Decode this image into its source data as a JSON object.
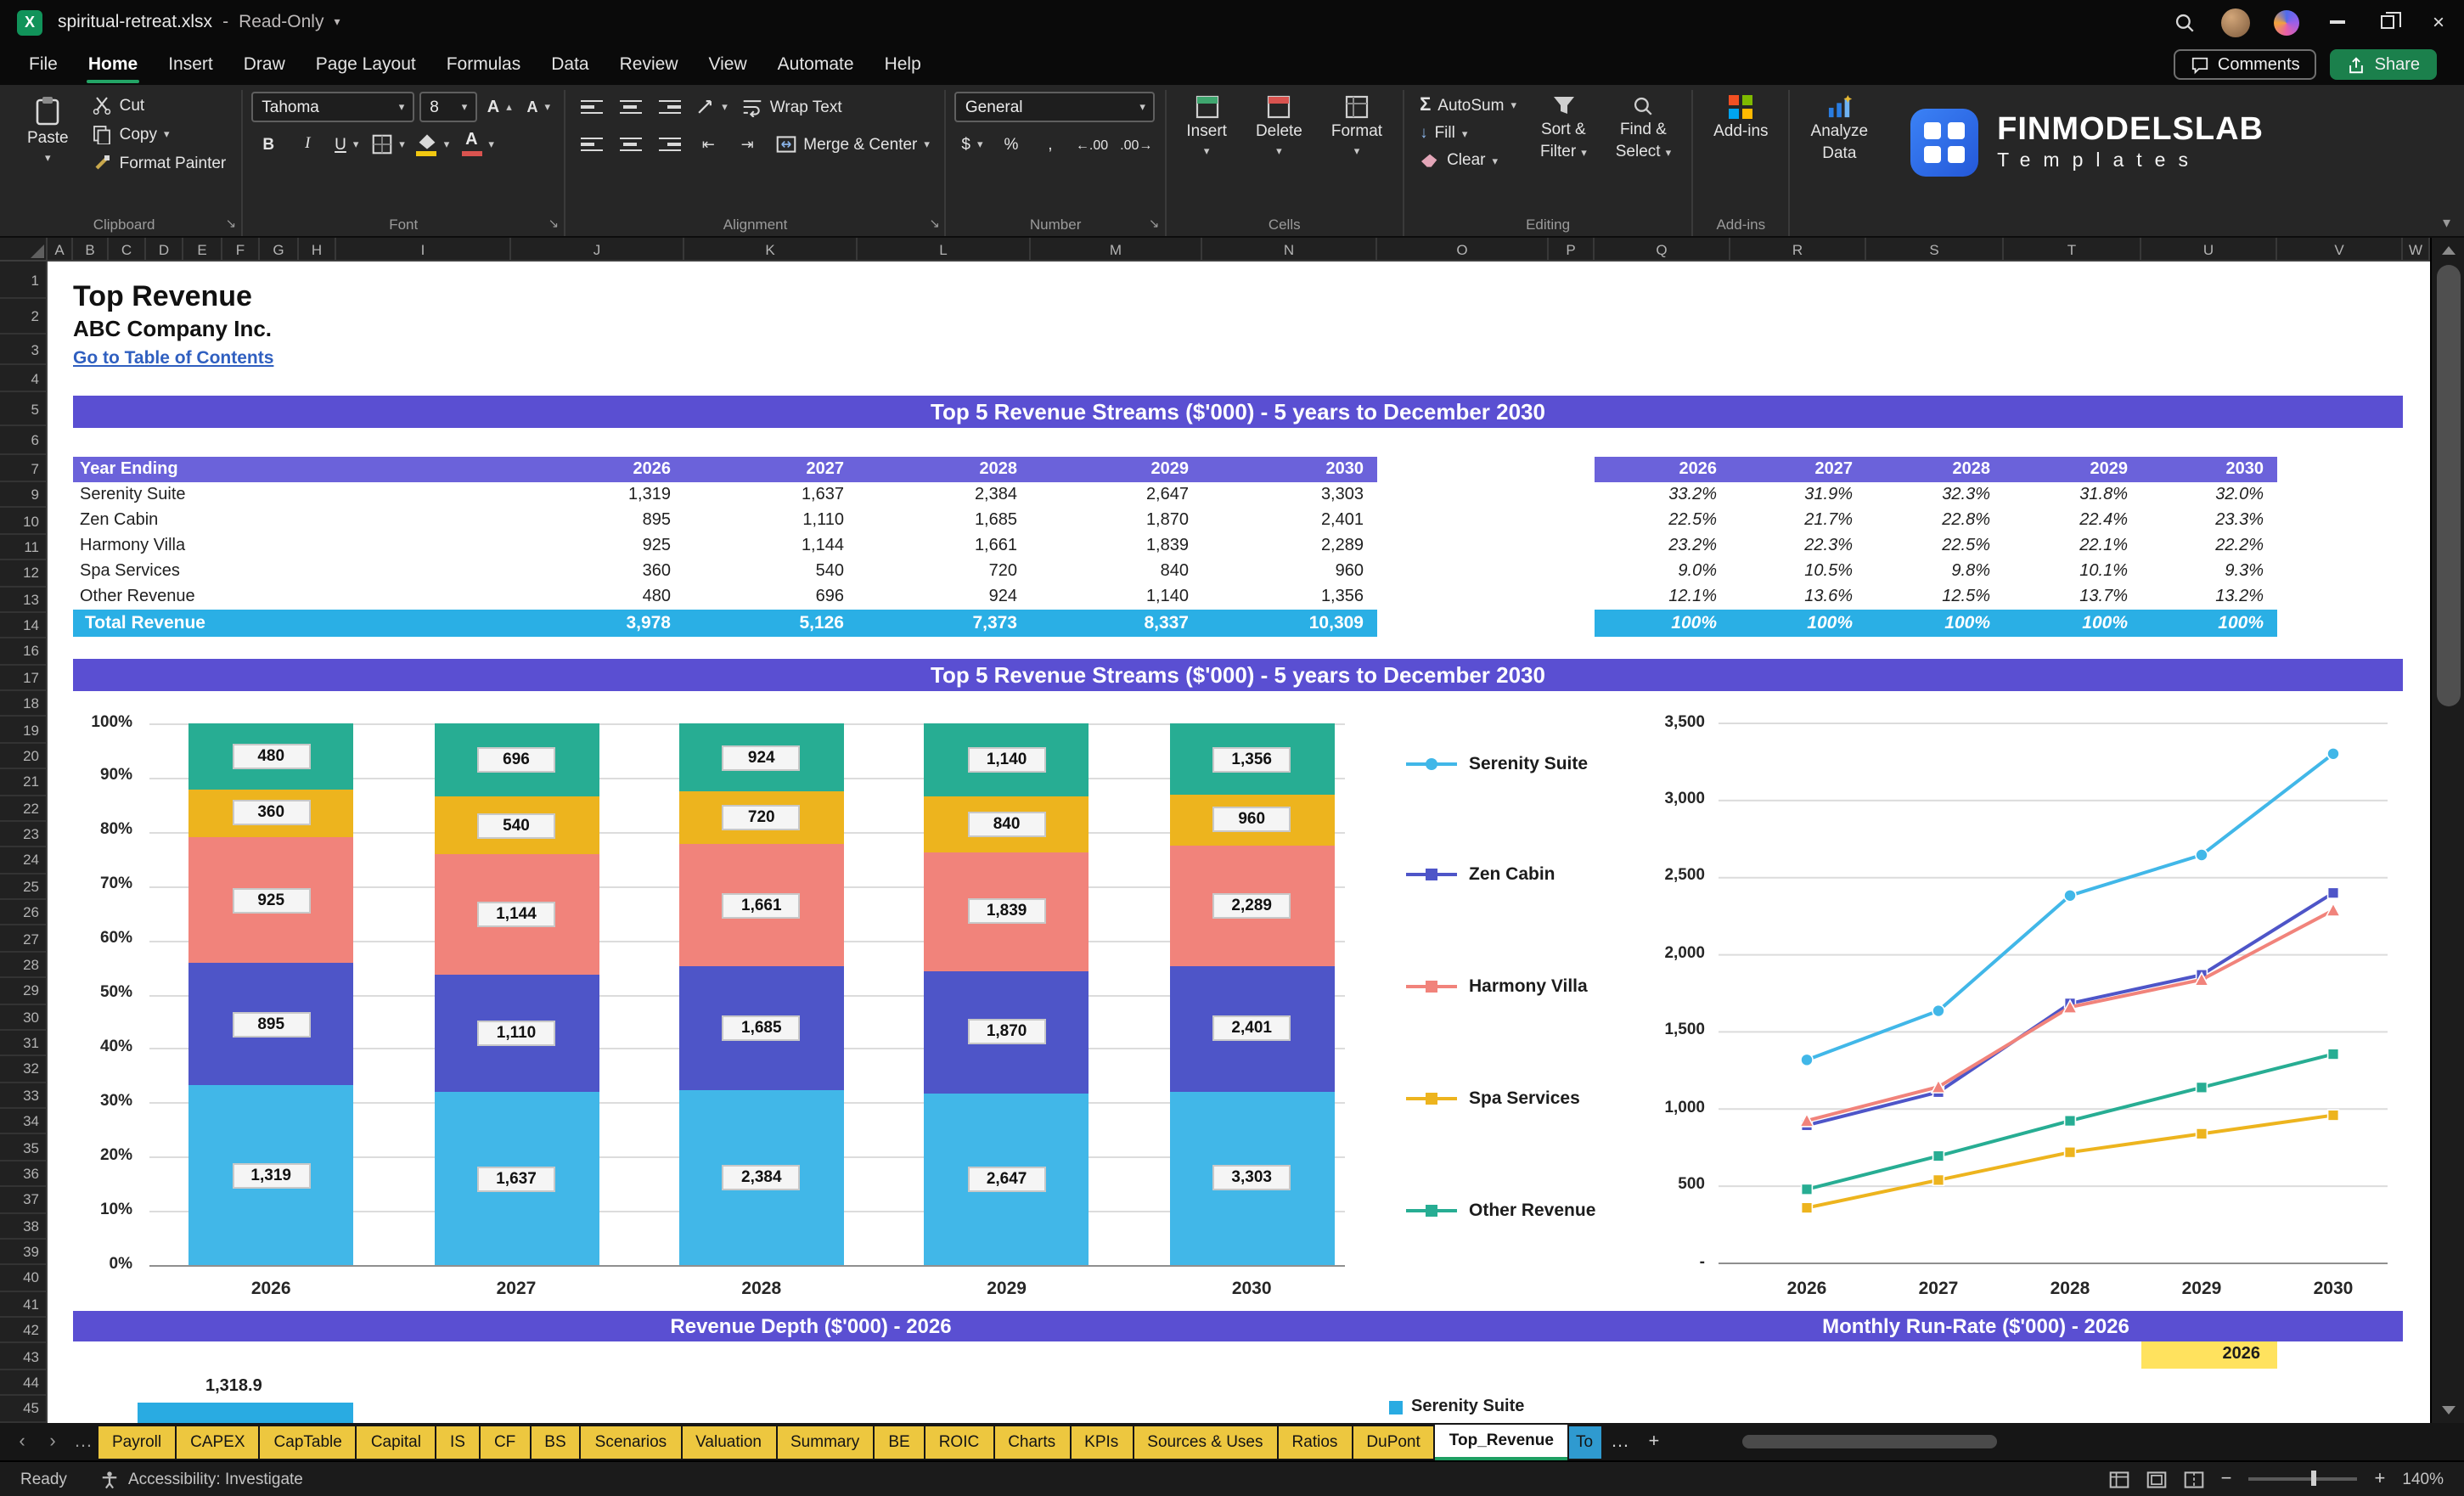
{
  "titlebar": {
    "filename": "spiritual-retreat.xlsx",
    "separator": "-",
    "mode": "Read-Only"
  },
  "menubar": {
    "tabs": [
      "File",
      "Home",
      "Insert",
      "Draw",
      "Page Layout",
      "Formulas",
      "Data",
      "Review",
      "View",
      "Automate",
      "Help"
    ],
    "active": "Home",
    "comments_label": "Comments",
    "share_label": "Share"
  },
  "ribbon": {
    "paste": "Paste",
    "cut": "Cut",
    "copy": "Copy",
    "format_painter": "Format Painter",
    "font_name": "Tahoma",
    "font_size": "8",
    "bold": "B",
    "italic": "I",
    "underline": "U",
    "wrap_text": "Wrap Text",
    "merge_center": "Merge & Center",
    "number_format": "General",
    "currency": "$",
    "percent": "%",
    "comma": ",",
    "inc_decimal": "←.00",
    "dec_decimal": ".00→",
    "insert": "Insert",
    "delete": "Delete",
    "format": "Format",
    "autosum": "AutoSum",
    "fill": "Fill",
    "clear": "Clear",
    "sort_filter_1": "Sort &",
    "sort_filter_2": "Filter",
    "find_select_1": "Find &",
    "find_select_2": "Select",
    "addins": "Add-ins",
    "analyze_1": "Analyze",
    "analyze_2": "Data",
    "groups": {
      "clipboard": "Clipboard",
      "font": "Font",
      "alignment": "Alignment",
      "number": "Number",
      "cells": "Cells",
      "editing": "Editing",
      "addins": "Add-ins"
    }
  },
  "brand": {
    "name": "FINMODELSLAB",
    "sub": "Templates"
  },
  "grid": {
    "columns": [
      "A",
      "B",
      "C",
      "D",
      "E",
      "F",
      "G",
      "H",
      "I",
      "J",
      "K",
      "L",
      "M",
      "N",
      "O",
      "P",
      "Q",
      "R",
      "S",
      "T",
      "U",
      "V",
      "W"
    ],
    "rows": [
      1,
      2,
      3,
      4,
      5,
      6,
      7,
      9,
      10,
      11,
      12,
      13,
      14,
      16,
      17,
      18,
      19,
      20,
      21,
      22,
      23,
      24,
      25,
      26,
      27,
      28,
      29,
      30,
      31,
      32,
      33,
      34,
      35,
      36,
      37,
      38,
      39,
      40,
      41,
      42,
      43,
      44,
      45
    ]
  },
  "sheet": {
    "title": "Top Revenue",
    "company": "ABC Company Inc.",
    "toc_link": "Go to Table of Contents",
    "banner_top": "Top 5 Revenue Streams ($'000) - 5 years to December 2030",
    "banner_chart": "Top 5 Revenue Streams ($'000) - 5 years to December 2030",
    "banner_depth": "Revenue Depth ($'000) - 2026",
    "banner_runrate": "Monthly Run-Rate ($'000) - 2026",
    "table": {
      "header_label": "Year Ending",
      "years": [
        "2026",
        "2027",
        "2028",
        "2029",
        "2030"
      ],
      "rows": [
        {
          "label": "Serenity Suite",
          "values": [
            "1,319",
            "1,637",
            "2,384",
            "2,647",
            "3,303"
          ],
          "pct": [
            "33.2%",
            "31.9%",
            "32.3%",
            "31.8%",
            "32.0%"
          ]
        },
        {
          "label": "Zen Cabin",
          "values": [
            "895",
            "1,110",
            "1,685",
            "1,870",
            "2,401"
          ],
          "pct": [
            "22.5%",
            "21.7%",
            "22.8%",
            "22.4%",
            "23.3%"
          ]
        },
        {
          "label": "Harmony Villa",
          "values": [
            "925",
            "1,144",
            "1,661",
            "1,839",
            "2,289"
          ],
          "pct": [
            "23.2%",
            "22.3%",
            "22.5%",
            "22.1%",
            "22.2%"
          ]
        },
        {
          "label": "Spa Services",
          "values": [
            "360",
            "540",
            "720",
            "840",
            "960"
          ],
          "pct": [
            "9.0%",
            "10.5%",
            "9.8%",
            "10.1%",
            "9.3%"
          ]
        },
        {
          "label": "Other Revenue",
          "values": [
            "480",
            "696",
            "924",
            "1,140",
            "1,356"
          ],
          "pct": [
            "12.1%",
            "13.6%",
            "12.5%",
            "13.7%",
            "13.2%"
          ]
        }
      ],
      "total": {
        "label": "Total Revenue",
        "values": [
          "3,978",
          "5,126",
          "7,373",
          "8,337",
          "10,309"
        ],
        "pct": [
          "100%",
          "100%",
          "100%",
          "100%",
          "100%"
        ]
      }
    },
    "depth_label": "1,318.9",
    "runrate_input_year": "2026",
    "runrate_legend": "Serenity Suite"
  },
  "chart_data": [
    {
      "type": "bar",
      "subtype": "percent-stacked",
      "title": "Top 5 Revenue Streams ($'000) - 5 years to December 2030",
      "categories": [
        "2026",
        "2027",
        "2028",
        "2029",
        "2030"
      ],
      "series": [
        {
          "name": "Serenity Suite",
          "color": "#41B7E8",
          "values": [
            1319,
            1637,
            2384,
            2647,
            3303
          ],
          "labels": [
            "1,319",
            "1,637",
            "2,384",
            "2,647",
            "3,303"
          ],
          "pct": [
            33.2,
            31.9,
            32.3,
            31.8,
            32.0
          ]
        },
        {
          "name": "Zen Cabin",
          "color": "#4E55C8",
          "values": [
            895,
            1110,
            1685,
            1870,
            2401
          ],
          "labels": [
            "895",
            "1,110",
            "1,685",
            "1,870",
            "2,401"
          ],
          "pct": [
            22.5,
            21.7,
            22.8,
            22.4,
            23.3
          ]
        },
        {
          "name": "Harmony Villa",
          "color": "#F1837B",
          "values": [
            925,
            1144,
            1661,
            1839,
            2289
          ],
          "labels": [
            "925",
            "1,144",
            "1,661",
            "1,839",
            "2,289"
          ],
          "pct": [
            23.2,
            22.3,
            22.5,
            22.1,
            22.2
          ]
        },
        {
          "name": "Spa Services",
          "color": "#EDB41E",
          "values": [
            360,
            540,
            720,
            840,
            960
          ],
          "labels": [
            "360",
            "540",
            "720",
            "840",
            "960"
          ],
          "pct": [
            9.0,
            10.5,
            9.8,
            10.1,
            9.3
          ]
        },
        {
          "name": "Other Revenue",
          "color": "#27AD93",
          "values": [
            480,
            696,
            924,
            1140,
            1356
          ],
          "labels": [
            "480",
            "696",
            "924",
            "1,140",
            "1,356"
          ],
          "pct": [
            12.1,
            13.6,
            12.5,
            13.7,
            13.2
          ]
        }
      ],
      "y_ticks": [
        "100%",
        "90%",
        "80%",
        "70%",
        "60%",
        "50%",
        "40%",
        "30%",
        "20%",
        "10%",
        "0%"
      ],
      "ylim": [
        0,
        100
      ],
      "grid": true,
      "legend": false
    },
    {
      "type": "line",
      "categories": [
        "2026",
        "2027",
        "2028",
        "2029",
        "2030"
      ],
      "series": [
        {
          "name": "Serenity Suite",
          "color": "#41B7E8",
          "marker": "circle",
          "values": [
            1319,
            1637,
            2384,
            2647,
            3303
          ]
        },
        {
          "name": "Zen Cabin",
          "color": "#4E55C8",
          "marker": "square",
          "values": [
            895,
            1110,
            1685,
            1870,
            2401
          ]
        },
        {
          "name": "Harmony Villa",
          "color": "#F1837B",
          "marker": "triangle",
          "values": [
            925,
            1144,
            1661,
            1839,
            2289
          ]
        },
        {
          "name": "Spa Services",
          "color": "#EDB41E",
          "marker": "square",
          "values": [
            360,
            540,
            720,
            840,
            960
          ]
        },
        {
          "name": "Other Revenue",
          "color": "#27AD93",
          "marker": "square",
          "values": [
            480,
            696,
            924,
            1140,
            1356
          ]
        }
      ],
      "y_ticks": [
        "3,500",
        "3,000",
        "2,500",
        "2,000",
        "1,500",
        "1,000",
        "500",
        "-"
      ],
      "ylim": [
        0,
        3500
      ],
      "grid": true,
      "legend_position": "left"
    },
    {
      "type": "bar",
      "subtype": "horizontal",
      "title": "Revenue Depth ($'000) - 2026",
      "partial": true,
      "categories": [
        "Serenity Suite"
      ],
      "series": [
        {
          "name": "Serenity Suite",
          "color": "#29ABE2",
          "values": [
            1318.9
          ],
          "labels": [
            "1,318.9"
          ]
        }
      ]
    }
  ],
  "sheet_tabs": {
    "items": [
      {
        "label": "Payroll",
        "color": "#EDC73F"
      },
      {
        "label": "CAPEX",
        "color": "#EDC73F"
      },
      {
        "label": "CapTable",
        "color": "#EDC73F"
      },
      {
        "label": "Capital",
        "color": "#EDC73F"
      },
      {
        "label": "IS",
        "color": "#EDC73F"
      },
      {
        "label": "CF",
        "color": "#EDC73F"
      },
      {
        "label": "BS",
        "color": "#EDC73F"
      },
      {
        "label": "Scenarios",
        "color": "#EDC73F"
      },
      {
        "label": "Valuation",
        "color": "#EDC73F"
      },
      {
        "label": "Summary",
        "color": "#EDC73F"
      },
      {
        "label": "BE",
        "color": "#EDC73F"
      },
      {
        "label": "ROIC",
        "color": "#EDC73F"
      },
      {
        "label": "Charts",
        "color": "#EDC73F"
      },
      {
        "label": "KPIs",
        "color": "#EDC73F"
      },
      {
        "label": "Sources & Uses",
        "color": "#EDC73F"
      },
      {
        "label": "Ratios",
        "color": "#EDC73F"
      },
      {
        "label": "DuPont",
        "color": "#EDC73F"
      },
      {
        "label": "Top_Revenue",
        "color": "#FFFFFF",
        "active": true
      },
      {
        "label": "To",
        "color": "#2F9AD0",
        "truncated": true
      }
    ]
  },
  "statusbar": {
    "ready": "Ready",
    "accessibility": "Accessibility: Investigate",
    "zoom_level": "140%"
  }
}
